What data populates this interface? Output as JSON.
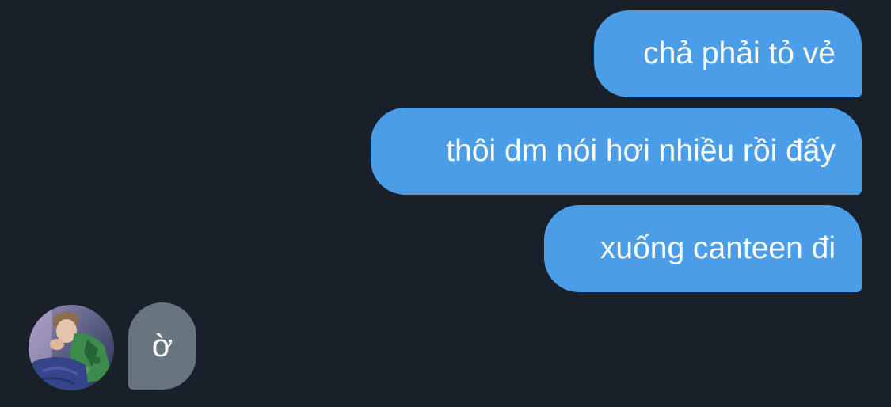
{
  "messages": [
    {
      "direction": "sent",
      "text": "chả phải tỏ vẻ"
    },
    {
      "direction": "sent",
      "text": "thôi dm nói hơi nhiều rồi đấy"
    },
    {
      "direction": "sent",
      "text": "xuống canteen đi"
    },
    {
      "direction": "received",
      "text": "ờ"
    }
  ],
  "colors": {
    "background": "#18202a",
    "sent_bubble": "#4b9de8",
    "received_bubble": "#68757f",
    "text": "#ffffff"
  },
  "avatar": {
    "icon": "user-photo-avatar"
  }
}
